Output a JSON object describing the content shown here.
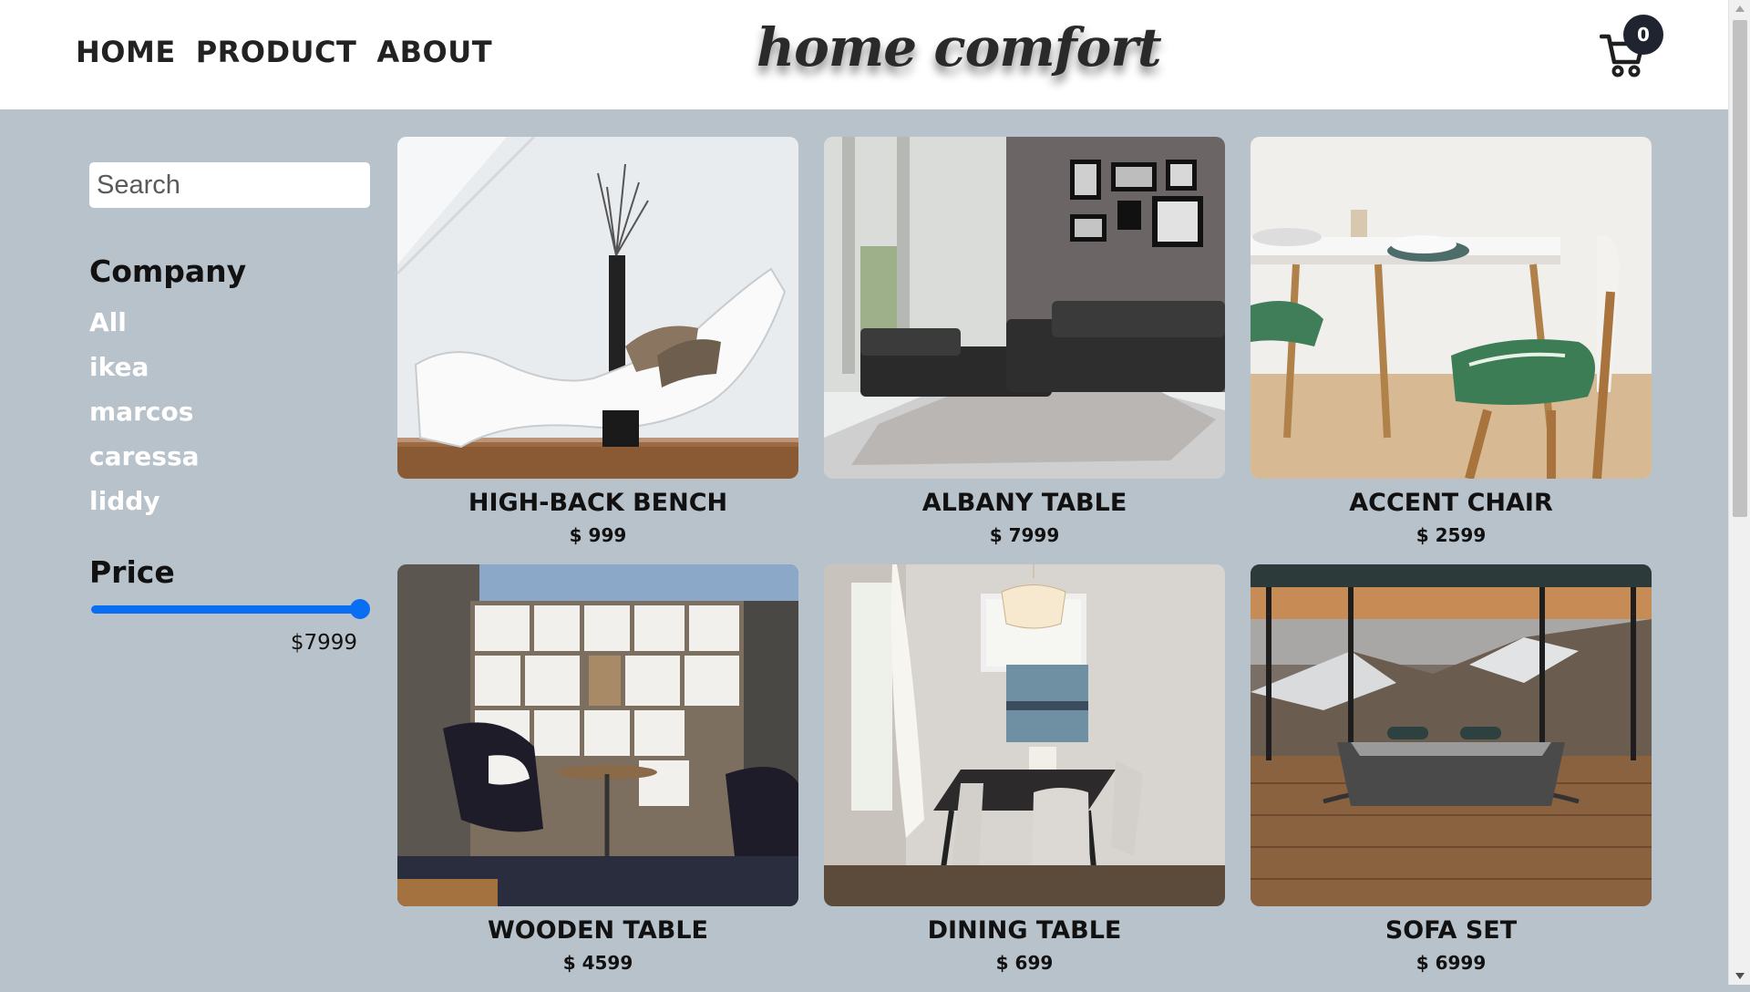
{
  "header": {
    "nav": [
      "HOME",
      "PRODUCT",
      "ABOUT"
    ],
    "logo": "home comfort",
    "cart_count": "0"
  },
  "sidebar": {
    "search_placeholder": "Search",
    "company_title": "Company",
    "companies": [
      "All",
      "ikea",
      "marcos",
      "caressa",
      "liddy"
    ],
    "price_title": "Price",
    "price_value": "$7999",
    "slider_level": 1.0
  },
  "products": [
    {
      "name": "HIGH-BACK BENCH",
      "price": "$ 999"
    },
    {
      "name": "ALBANY TABLE",
      "price": "$ 7999"
    },
    {
      "name": "ACCENT CHAIR",
      "price": "$ 2599"
    },
    {
      "name": "WOODEN TABLE",
      "price": "$ 4599"
    },
    {
      "name": "DINING TABLE",
      "price": "$ 699"
    },
    {
      "name": "SOFA SET",
      "price": "$ 6999"
    }
  ],
  "colors": {
    "background": "#b8c2cb",
    "accent": "#0a6ef2",
    "badge": "#1f2430"
  },
  "icons": {
    "cart": "shopping-cart-icon"
  }
}
